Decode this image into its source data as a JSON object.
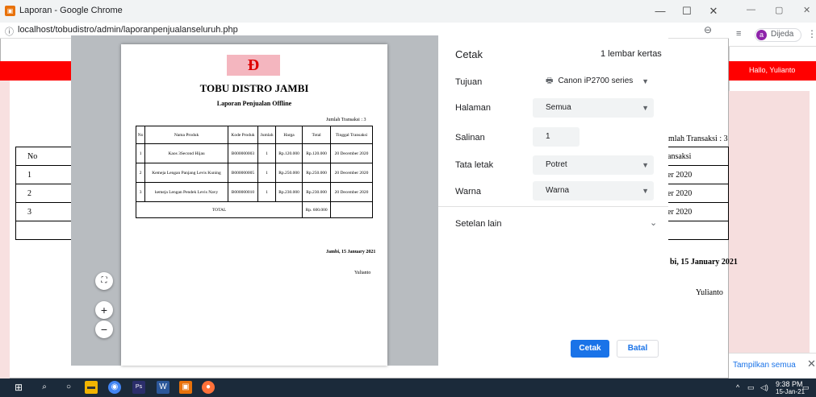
{
  "window": {
    "title": "Laporan - Google Chrome",
    "url": "localhost/tobudistro/admin/laporanpenjualanseluruh.php",
    "minimize": "—",
    "maximize": "☐",
    "close": "✕"
  },
  "bg_window": {
    "profile_initial": "a",
    "profile_name": "Dijeda",
    "greeting": "Hallo, Yulianto",
    "show_all": "Tampilkan semua",
    "close": "✕"
  },
  "page_behind": {
    "left_table": {
      "header": "No",
      "rows": [
        "1",
        "2",
        "3"
      ]
    },
    "right_total": "mlah Transaksi : 3",
    "right_table": {
      "header": "ansaksi",
      "rows": [
        "er 2020",
        "er 2020",
        "er 2020"
      ]
    },
    "right_date": "bi, 15 January 2021",
    "right_signer": "Yulianto"
  },
  "report": {
    "store_name": "TOBU DISTRO JAMBI",
    "subtitle": "Laporan Penjualan Offline",
    "total_transactions": "Jumlah Transaksi : 3",
    "columns": [
      "No",
      "Nama Produk",
      "Kode Produk",
      "Jumlah",
      "Harga",
      "Total",
      "Tinggal Transaksi"
    ],
    "rows": [
      [
        "1",
        "Kaos 3Second Hijau",
        "B000000003",
        "1",
        "Rp.120.000",
        "Rp.120.000",
        "20 December 2020"
      ],
      [
        "2",
        "Kemeja Lengan Panjang Levis Kuning",
        "B000000005",
        "1",
        "Rp.250.000",
        "Rp.250.000",
        "20 December 2020"
      ],
      [
        "3",
        "kemeja Lengan Pendek Levis Navy",
        "B000000010",
        "1",
        "Rp.230.000",
        "Rp.230.000",
        "20 December 2020"
      ]
    ],
    "total_label": "TOTAL",
    "total_value": "Rp. 600.000",
    "place_date": "Jambi, 15 January 2021",
    "signer": "Yulianto"
  },
  "print_dialog": {
    "title": "Cetak",
    "sheet_count": "1 lembar kertas",
    "destination_label": "Tujuan",
    "destination_value": "Canon iP2700 series",
    "pages_label": "Halaman",
    "pages_value": "Semua",
    "copies_label": "Salinan",
    "copies_value": "1",
    "layout_label": "Tata letak",
    "layout_value": "Potret",
    "color_label": "Warna",
    "color_value": "Warna",
    "more_settings": "Setelan lain",
    "print_button": "Cetak",
    "cancel_button": "Batal"
  },
  "taskbar": {
    "time": "9:38 PM",
    "date": "15-Jan-21"
  },
  "colors": {
    "accent": "#1a73e8",
    "header_red": "#ff0000",
    "taskbar": "#1b2a3a"
  }
}
